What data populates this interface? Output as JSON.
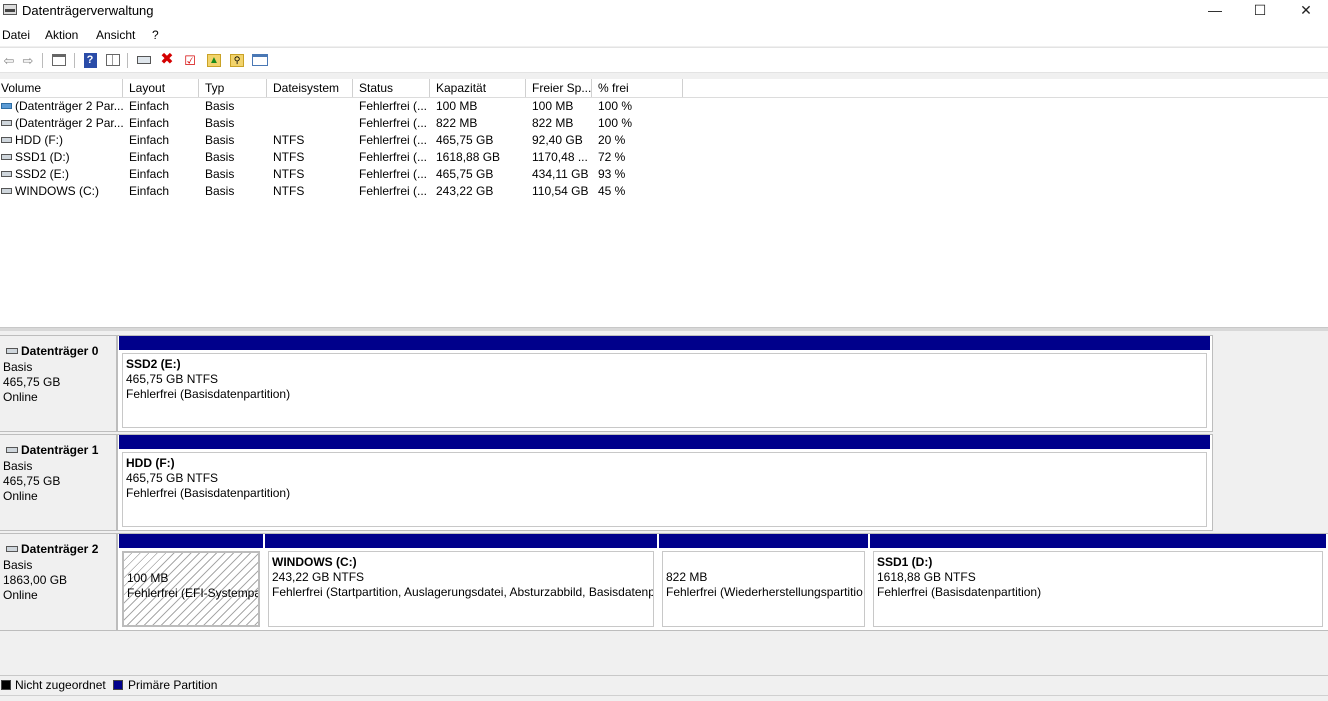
{
  "window": {
    "title": "Datenträgerverwaltung",
    "minimize": "—",
    "maximize": "☐",
    "close": "✕"
  },
  "menu": [
    "Datei",
    "Aktion",
    "Ansicht",
    "?"
  ],
  "toolbar": {
    "icons": [
      "back-arrow-icon",
      "forward-arrow-icon",
      "console-tree-icon",
      "help-icon",
      "properties-icon",
      "connect-icon",
      "delete-icon",
      "check-icon",
      "folder-up-icon",
      "search-folder-icon",
      "window-icon"
    ]
  },
  "volume_list": {
    "columns": [
      "Volume",
      "Layout",
      "Typ",
      "Dateisystem",
      "Status",
      "Kapazität",
      "Freier Sp...",
      "% frei"
    ],
    "rows": [
      {
        "volume": "(Datenträger 2 Par...",
        "layout": "Einfach",
        "typ": "Basis",
        "dateisystem": "",
        "status": "Fehlerfrei (...",
        "kapazitaet": "100 MB",
        "frei": "100 MB",
        "prozent": "100 %",
        "icon": "blue"
      },
      {
        "volume": "(Datenträger 2 Par...",
        "layout": "Einfach",
        "typ": "Basis",
        "dateisystem": "",
        "status": "Fehlerfrei (...",
        "kapazitaet": "822 MB",
        "frei": "822 MB",
        "prozent": "100 %",
        "icon": "gray"
      },
      {
        "volume": "HDD (F:)",
        "layout": "Einfach",
        "typ": "Basis",
        "dateisystem": "NTFS",
        "status": "Fehlerfrei (...",
        "kapazitaet": "465,75 GB",
        "frei": "92,40 GB",
        "prozent": "20 %",
        "icon": "gray"
      },
      {
        "volume": "SSD1 (D:)",
        "layout": "Einfach",
        "typ": "Basis",
        "dateisystem": "NTFS",
        "status": "Fehlerfrei (...",
        "kapazitaet": "1618,88 GB",
        "frei": "1170,48 ...",
        "prozent": "72 %",
        "icon": "gray"
      },
      {
        "volume": "SSD2 (E:)",
        "layout": "Einfach",
        "typ": "Basis",
        "dateisystem": "NTFS",
        "status": "Fehlerfrei (...",
        "kapazitaet": "465,75 GB",
        "frei": "434,11 GB",
        "prozent": "93 %",
        "icon": "gray"
      },
      {
        "volume": "WINDOWS (C:)",
        "layout": "Einfach",
        "typ": "Basis",
        "dateisystem": "NTFS",
        "status": "Fehlerfrei (...",
        "kapazitaet": "243,22 GB",
        "frei": "110,54 GB",
        "prozent": "45 %",
        "icon": "gray"
      }
    ]
  },
  "disks": [
    {
      "name": "Datenträger 0",
      "type": "Basis",
      "size": "465,75 GB",
      "state": "Online",
      "partitions": [
        {
          "title": "SSD2  (E:)",
          "line1": "465,75 GB NTFS",
          "line2": "Fehlerfrei (Basisdatenpartition)"
        }
      ]
    },
    {
      "name": "Datenträger 1",
      "type": "Basis",
      "size": "465,75 GB",
      "state": "Online",
      "partitions": [
        {
          "title": "HDD  (F:)",
          "line1": "465,75 GB NTFS",
          "line2": "Fehlerfrei (Basisdatenpartition)"
        }
      ]
    },
    {
      "name": "Datenträger 2",
      "type": "Basis",
      "size": "1863,00 GB",
      "state": "Online",
      "partitions": [
        {
          "title": "",
          "line1": "100 MB",
          "line2": "Fehlerfrei (EFI-Systempar"
        },
        {
          "title": "WINDOWS  (C:)",
          "line1": "243,22 GB NTFS",
          "line2": "Fehlerfrei (Startpartition, Auslagerungsdatei, Absturzabbild, Basisdatenp"
        },
        {
          "title": "",
          "line1": "822 MB",
          "line2": "Fehlerfrei (Wiederherstellungspartitio"
        },
        {
          "title": "SSD1  (D:)",
          "line1": "1618,88 GB NTFS",
          "line2": "Fehlerfrei (Basisdatenpartition)"
        }
      ]
    }
  ],
  "legend": [
    {
      "label": "Nicht zugeordnet",
      "color": "#000000"
    },
    {
      "label": "Primäre Partition",
      "color": "#00008b"
    }
  ]
}
